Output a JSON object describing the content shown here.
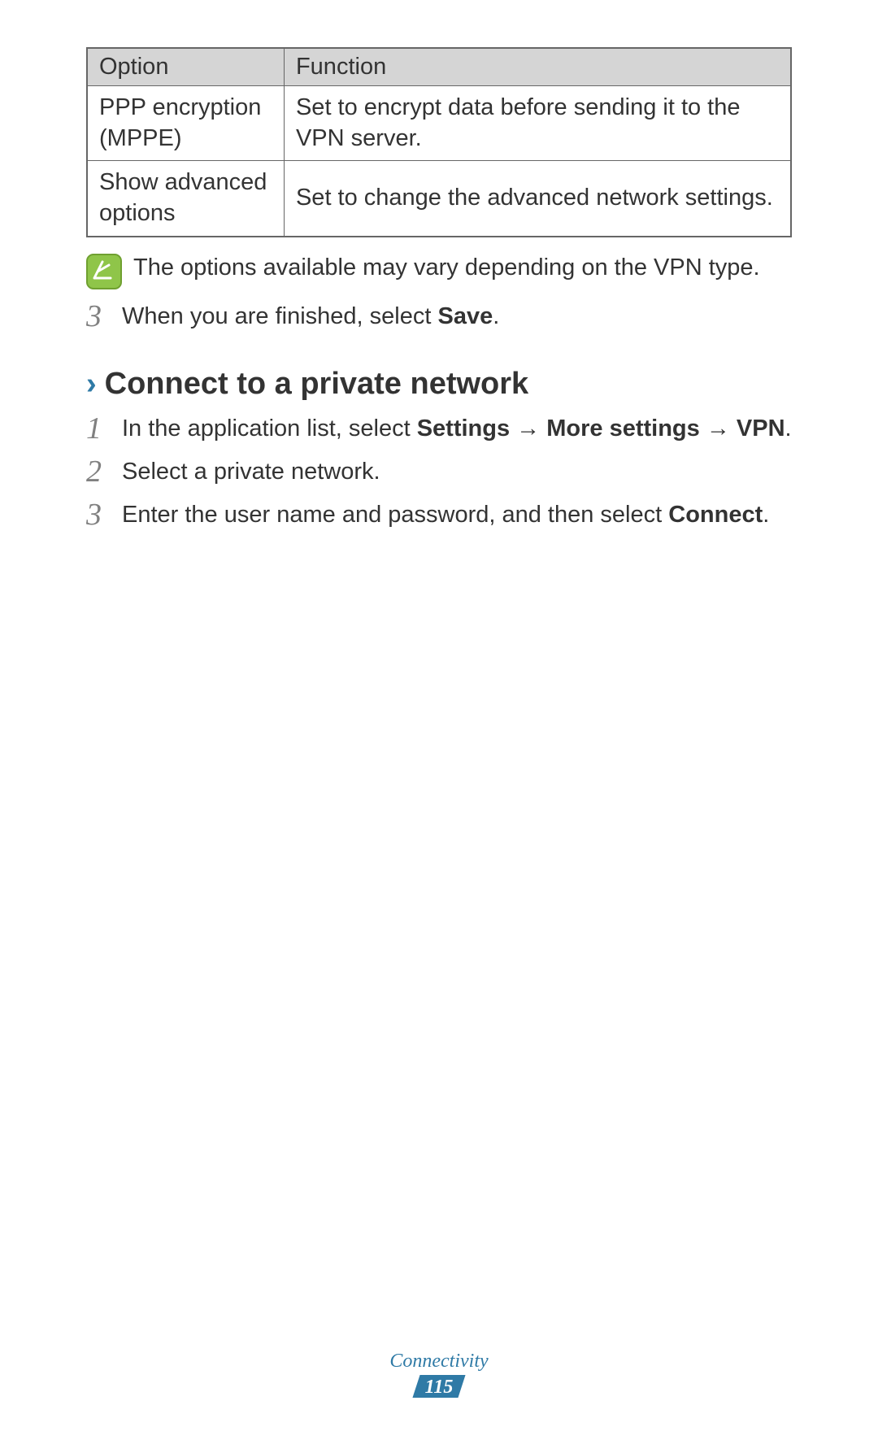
{
  "table": {
    "header": {
      "option": "Option",
      "function": "Function"
    },
    "rows": [
      {
        "option": "PPP encryption (MPPE)",
        "function": "Set to encrypt data before sending it to the VPN server."
      },
      {
        "option": "Show advanced options",
        "function": "Set to change the advanced network settings."
      }
    ]
  },
  "note": "The options available may vary depending on the VPN type.",
  "step3_top": {
    "number": "3",
    "prefix": "When you are finished, select ",
    "bold": "Save",
    "suffix": "."
  },
  "section": {
    "chevron": "›",
    "title": "Connect to a private network"
  },
  "steps": {
    "s1": {
      "number": "1",
      "prefix": "In the application list, select ",
      "b1": "Settings",
      "arrow1": " → ",
      "b2": "More settings",
      "arrow2": " → ",
      "b3": "VPN",
      "suffix": "."
    },
    "s2": {
      "number": "2",
      "text": "Select a private network."
    },
    "s3": {
      "number": "3",
      "prefix": "Enter the user name and password, and then select ",
      "bold": "Connect",
      "suffix": "."
    }
  },
  "footer": {
    "category": "Connectivity",
    "page": "115"
  }
}
